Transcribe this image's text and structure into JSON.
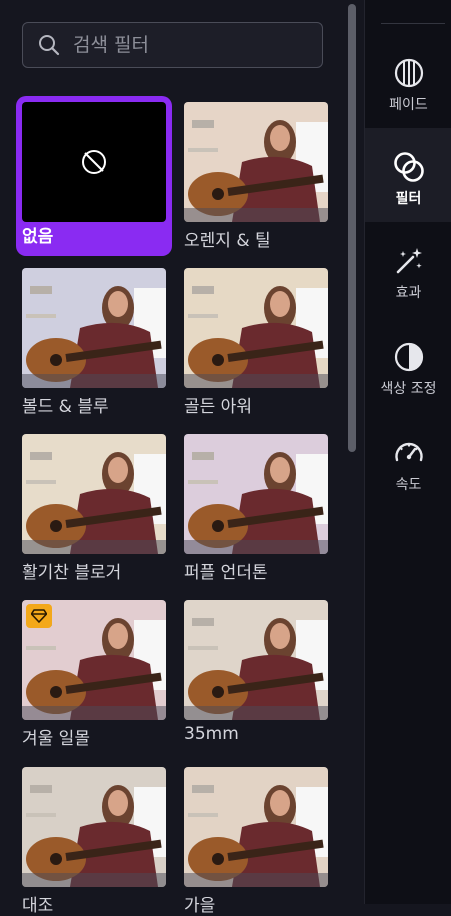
{
  "search": {
    "placeholder": "검색 필터"
  },
  "filters": [
    {
      "label": "없음",
      "selected": true
    },
    {
      "label": "오렌지 & 틸"
    },
    {
      "label": "볼드 & 블루"
    },
    {
      "label": "골든 아워"
    },
    {
      "label": "활기찬 블로거"
    },
    {
      "label": "퍼플 언더톤"
    },
    {
      "label": "겨울 일몰",
      "premium": true
    },
    {
      "label": "35mm"
    },
    {
      "label": "대조"
    },
    {
      "label": "가을"
    }
  ],
  "sidebar": {
    "items": [
      {
        "label": "페이드",
        "icon": "fade-icon"
      },
      {
        "label": "필터",
        "icon": "filter-icon",
        "active": true
      },
      {
        "label": "효과",
        "icon": "magic-wand-icon"
      },
      {
        "label": "색상 조정",
        "icon": "contrast-icon"
      },
      {
        "label": "속도",
        "icon": "speedometer-icon"
      }
    ]
  },
  "colors": {
    "accent": "#8a2bf2",
    "premium": "#f3a81a"
  }
}
